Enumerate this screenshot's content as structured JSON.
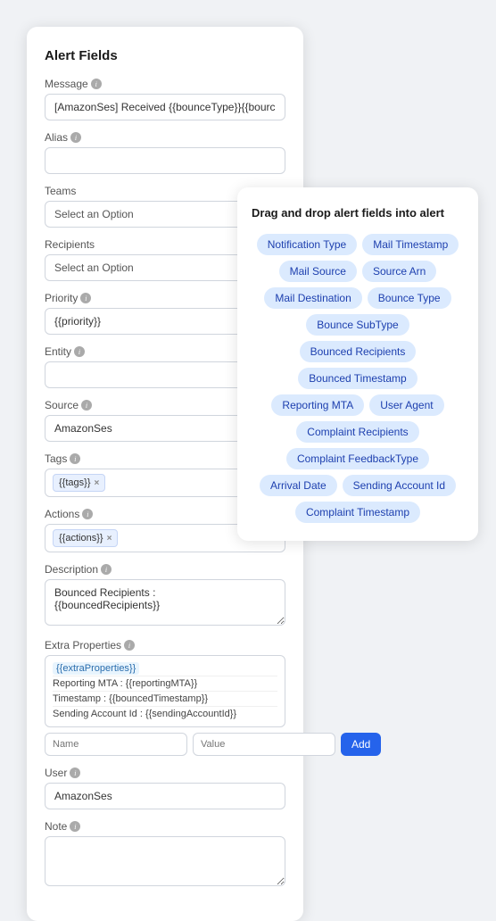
{
  "main_card": {
    "title": "Alert Fields",
    "fields": {
      "message_label": "Message",
      "message_value": "[AmazonSes] Received {{bounceType}}{{bourceSubType}}",
      "alias_label": "Alias",
      "alias_value": "",
      "teams_label": "Teams",
      "teams_placeholder": "Select an Option",
      "recipients_label": "Recipients",
      "recipients_placeholder": "Select an Option",
      "priority_label": "Priority",
      "priority_value": "{{priority}}",
      "entity_label": "Entity",
      "entity_value": "",
      "source_label": "Source",
      "source_value": "AmazonSes",
      "tags_label": "Tags",
      "tags": [
        {
          "label": "{{tags}}",
          "id": "tags"
        }
      ],
      "actions_label": "Actions",
      "actions": [
        {
          "label": "{{actions}}",
          "id": "actions"
        }
      ],
      "description_label": "Description",
      "description_value": "Bounced Recipients :\n{{bouncedRecipients}}",
      "extra_props_label": "Extra Properties",
      "extra_props_highlight": "{{extraProperties}}",
      "extra_props_items": [
        "Reporting MTA : {{reportingMTA}}",
        "Timestamp : {{bouncedTimestamp}}",
        "Sending Account Id : {{sendingAccountId}}"
      ],
      "name_placeholder": "Name",
      "value_placeholder": "Value",
      "add_label": "Add",
      "user_label": "User",
      "user_value": "AmazonSes",
      "note_label": "Note",
      "note_value": ""
    }
  },
  "dropdown_card": {
    "title": "Drag and drop alert fields into alert",
    "fields": [
      "Notification Type",
      "Mail Timestamp",
      "Mail Source",
      "Source Arn",
      "Mail Destination",
      "Bounce Type",
      "Bounce SubType",
      "Bounced Recipients",
      "Bounced Timestamp",
      "Reporting MTA",
      "User Agent",
      "Complaint Recipients",
      "Complaint FeedbackType",
      "Arrival Date",
      "Sending Account Id",
      "Complaint Timestamp"
    ]
  }
}
